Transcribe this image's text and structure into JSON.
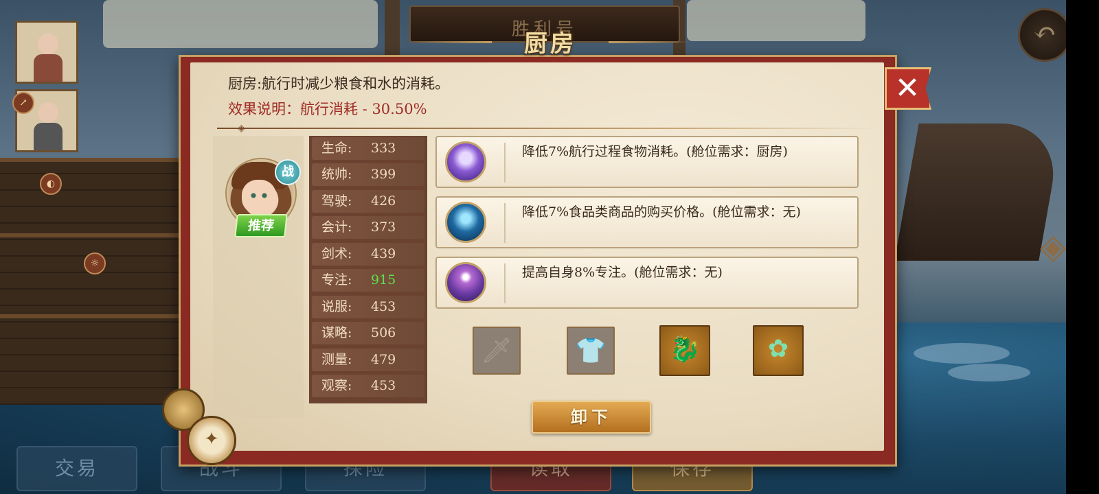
{
  "scene": {
    "ship_name": "胜利号",
    "bottom_nav": [
      {
        "label": "交易"
      },
      {
        "label": "战斗"
      },
      {
        "label": "探险"
      },
      {
        "label": "读取"
      },
      {
        "label": "保存"
      }
    ]
  },
  "dialog": {
    "title": "厨房",
    "close_icon": "close-icon",
    "description": "厨房:航行时减少粮食和水的消耗。",
    "effect": "效果说明：航行消耗 - 30.50%",
    "officer": {
      "class_badge": "战",
      "recommend_badge": "推荐"
    },
    "stats": [
      {
        "label": "生命:",
        "value": "333",
        "highlight": false
      },
      {
        "label": "统帅:",
        "value": "399",
        "highlight": false
      },
      {
        "label": "驾驶:",
        "value": "426",
        "highlight": false
      },
      {
        "label": "会计:",
        "value": "373",
        "highlight": false
      },
      {
        "label": "剑术:",
        "value": "439",
        "highlight": false
      },
      {
        "label": "专注:",
        "value": "915",
        "highlight": true
      },
      {
        "label": "说服:",
        "value": "453",
        "highlight": false
      },
      {
        "label": "谋略:",
        "value": "506",
        "highlight": false
      },
      {
        "label": "测量:",
        "value": "479",
        "highlight": false
      },
      {
        "label": "观察:",
        "value": "453",
        "highlight": false
      }
    ],
    "skills": [
      {
        "icon": "fist-glow-icon",
        "text": "降低7%航行过程食物消耗。(舱位需求：厨房)"
      },
      {
        "icon": "silhouette-icon",
        "text": "降低7%食品类商品的购买价格。(舱位需求：无)"
      },
      {
        "icon": "third-eye-icon",
        "text": "提高自身8%专注。(舱位需求：无)"
      }
    ],
    "equipment": [
      {
        "icon": "sword-icon",
        "state": "empty"
      },
      {
        "icon": "armor-icon",
        "state": "empty"
      },
      {
        "icon": "jade-beast-icon",
        "state": "filled"
      },
      {
        "icon": "flower-hairpin-icon",
        "state": "filled"
      }
    ],
    "unload_label": "卸下"
  }
}
